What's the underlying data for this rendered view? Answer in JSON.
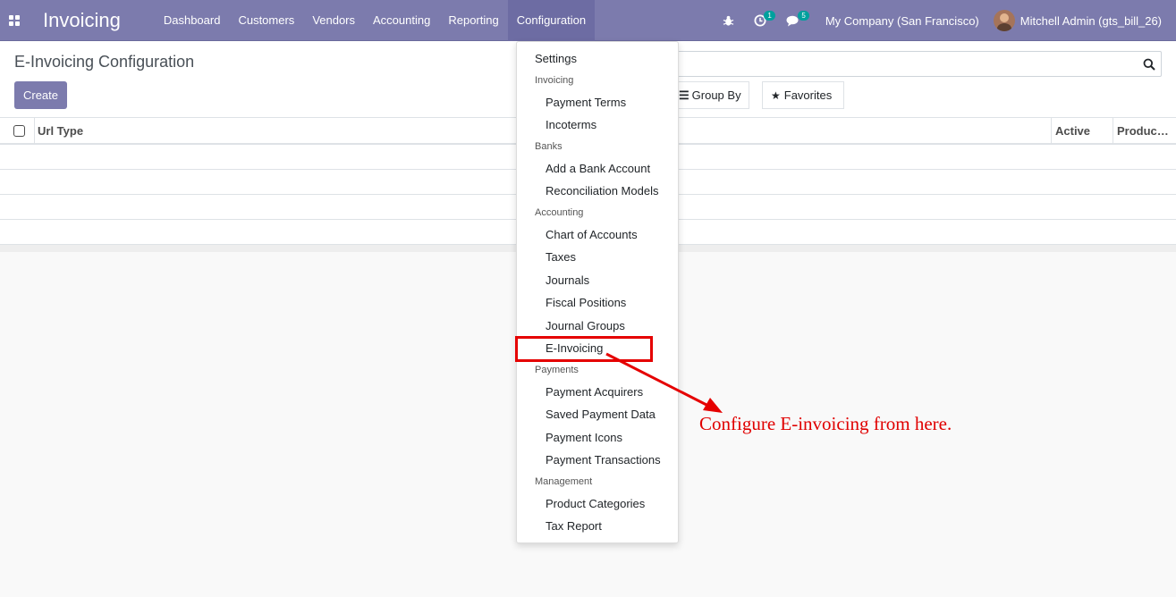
{
  "navbar": {
    "app_name": "Invoicing",
    "menu": [
      "Dashboard",
      "Customers",
      "Vendors",
      "Accounting",
      "Reporting",
      "Configuration"
    ],
    "activity_badge": "1",
    "messages_badge": "5",
    "company": "My Company (San Francisco)",
    "user": "Mitchell Admin (gts_bill_26)",
    "color": "#7c7bad"
  },
  "control_panel": {
    "title": "E-Invoicing Configuration",
    "create_label": "Create",
    "groupby_label": "Group By",
    "favorites_label": "Favorites"
  },
  "list": {
    "columns": [
      "Url Type",
      "Active",
      "Produc…"
    ]
  },
  "dropdown": {
    "settings": "Settings",
    "sections": [
      {
        "header": "Invoicing",
        "items": [
          "Payment Terms",
          "Incoterms"
        ]
      },
      {
        "header": "Banks",
        "items": [
          "Add a Bank Account",
          "Reconciliation Models"
        ]
      },
      {
        "header": "Accounting",
        "items": [
          "Chart of Accounts",
          "Taxes",
          "Journals",
          "Fiscal Positions",
          "Journal Groups",
          "E-Invoicing"
        ]
      },
      {
        "header": "Payments",
        "items": [
          "Payment Acquirers",
          "Saved Payment Data",
          "Payment Icons",
          "Payment Transactions"
        ]
      },
      {
        "header": "Management",
        "items": [
          "Product Categories",
          "Tax Report"
        ]
      }
    ]
  },
  "annotation": {
    "text": "Configure E-invoicing from here.",
    "color": "#e00000"
  }
}
